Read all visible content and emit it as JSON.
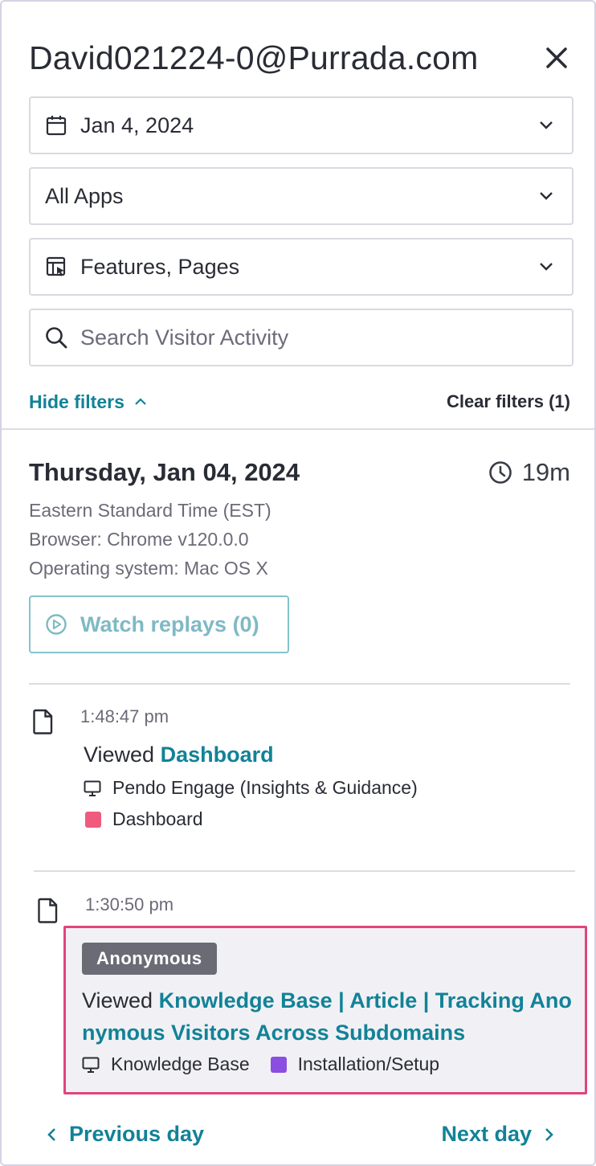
{
  "header": {
    "title": "David021224-0@Purrada.com"
  },
  "filters": {
    "date": "Jan 4, 2024",
    "apps": "All Apps",
    "types": "Features, Pages",
    "search_placeholder": "Search Visitor Activity",
    "hide_filters_label": "Hide filters",
    "clear_filters_label": "Clear filters (1)"
  },
  "day": {
    "title": "Thursday, Jan 04, 2024",
    "duration": "19m",
    "timezone": "Eastern Standard Time (EST)",
    "browser": "Browser: Chrome v120.0.0",
    "os": "Operating system: Mac OS X",
    "watch_replays_label": "Watch replays (0)"
  },
  "events": [
    {
      "time": "1:48:47 pm",
      "action": "Viewed",
      "target": "Dashboard",
      "app": "Pendo Engage (Insights & Guidance)",
      "group": "Dashboard",
      "group_color": "#f05a7e"
    },
    {
      "time": "1:30:50 pm",
      "badge": "Anonymous",
      "action": "Viewed",
      "target": "Knowledge Base | Article | Tracking Anonymous Visitors Across Subdomains",
      "app": "Knowledge Base",
      "group": "Installation/Setup",
      "group_color": "#8a4ee0"
    }
  ],
  "nav": {
    "prev_label": "Previous day",
    "next_label": "Next day"
  },
  "colors": {
    "accent": "#128297",
    "highlight_border": "#e0457b",
    "badge_bg": "#6a6b75"
  }
}
